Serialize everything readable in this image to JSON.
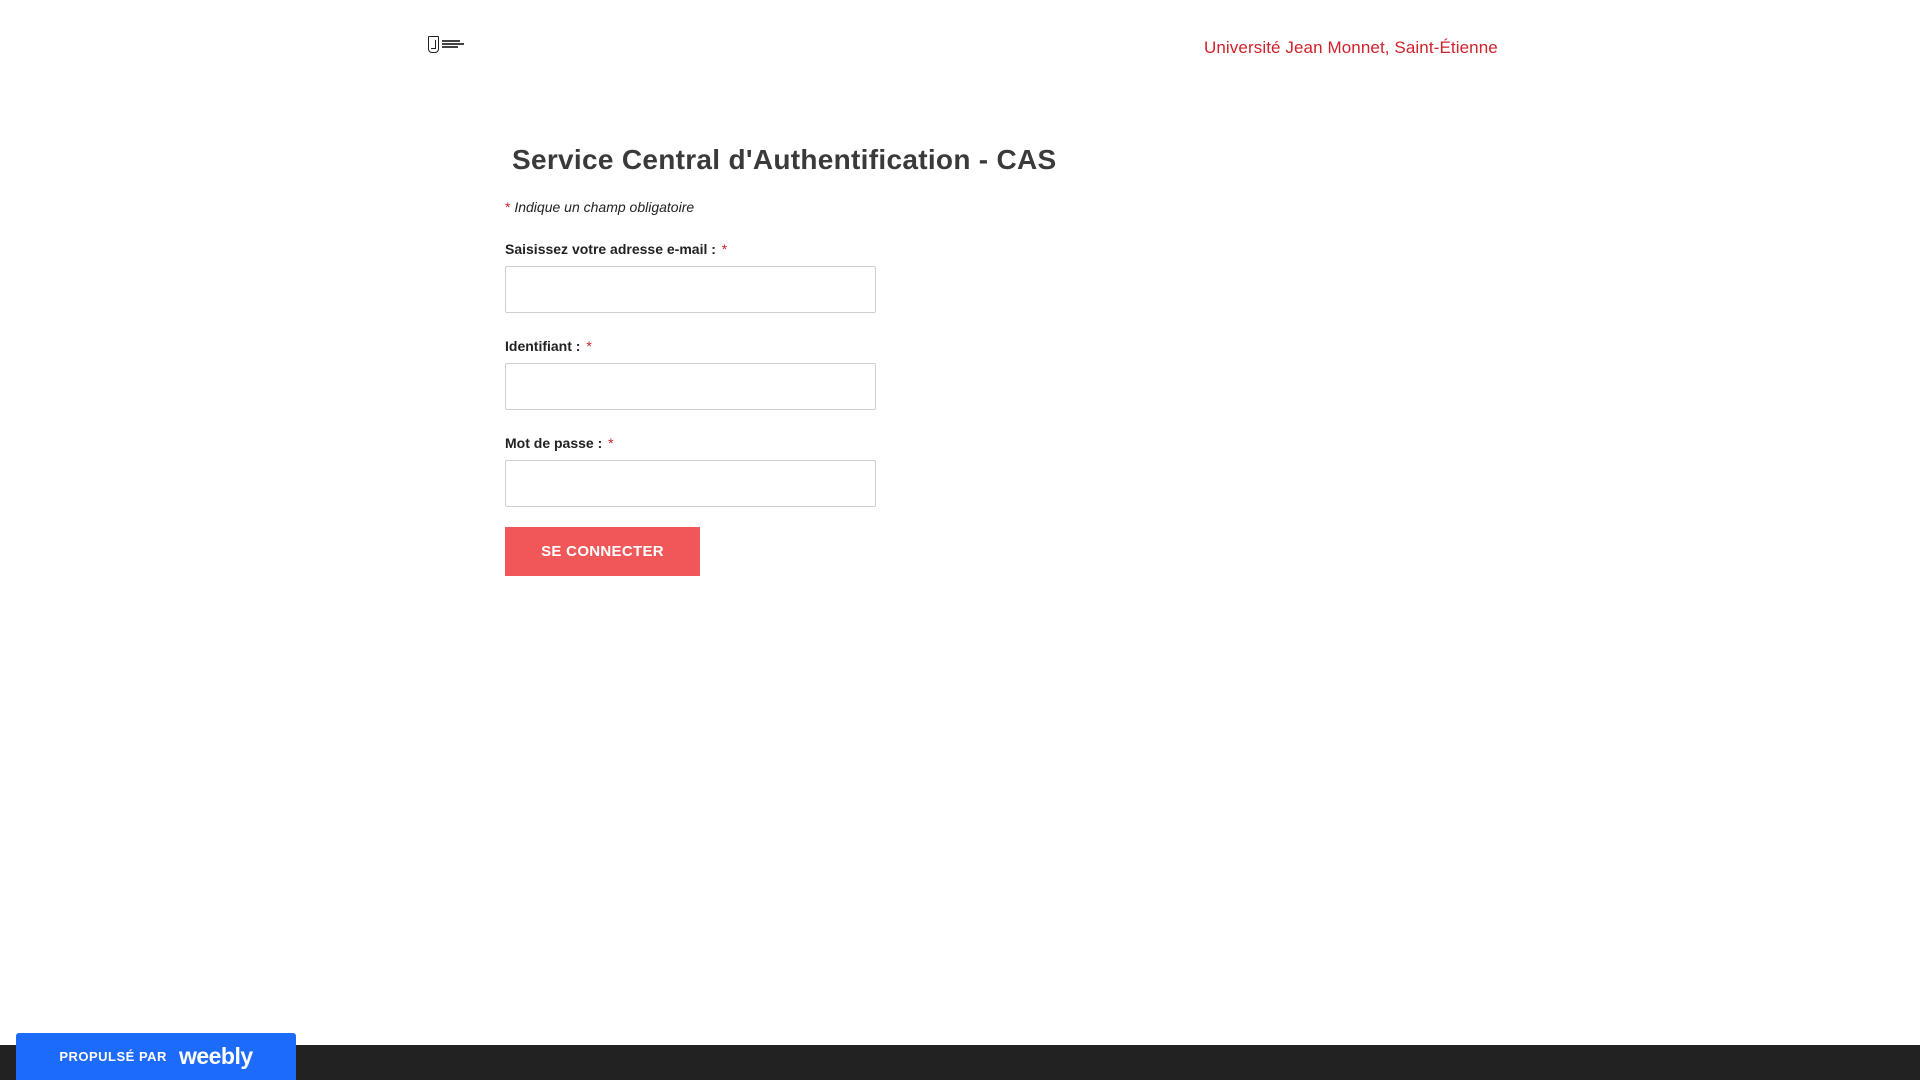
{
  "header": {
    "site_title": "Université Jean Monnet, Saint-Étienne",
    "logo": {
      "icon": "university-logo-icon"
    }
  },
  "main": {
    "title": "Service Central d'Authentification - CAS",
    "required_note": {
      "asterisk": "*",
      "text": "Indique un champ obligatoire"
    },
    "fields": [
      {
        "label": "Saisissez votre adresse e-mail :",
        "asterisk": "*",
        "value": ""
      },
      {
        "label": "Identifiant :",
        "asterisk": "*",
        "value": ""
      },
      {
        "label": "Mot de passe :",
        "asterisk": "*",
        "value": ""
      }
    ],
    "submit_label": "Se connecter"
  },
  "footer": {
    "powered_label": "PROPULSÉ PAR",
    "brand": "weebly"
  },
  "colors": {
    "accent_red": "#d0222b",
    "button": "#ef5758",
    "badge_blue": "#1d6bfa",
    "footer_dark": "#222222"
  }
}
